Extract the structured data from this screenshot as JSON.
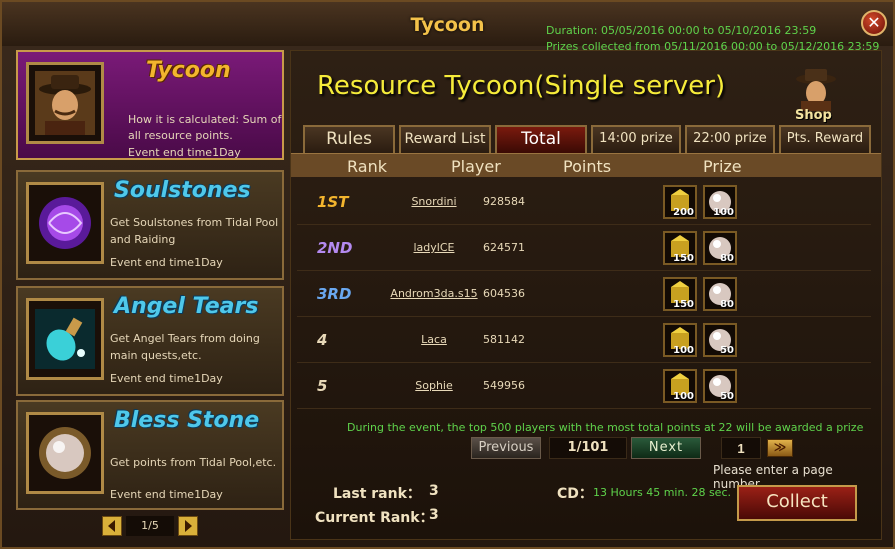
{
  "window": {
    "title": "Tycoon",
    "close": "✕"
  },
  "duration": {
    "line1": "Duration: 05/05/2016 00:00 to 05/10/2016 23:59",
    "line2": "Prizes collected from 05/11/2016 00:00 to 05/12/2016 23:59"
  },
  "sidebar": {
    "cards": [
      {
        "title": "Tycoon",
        "desc": "How it is calculated: Sum of all resource points.",
        "end": "Event end time1Day",
        "active": true
      },
      {
        "title": "Soulstones",
        "desc": "Get Soulstones from Tidal Pool and Raiding",
        "end": "Event end time1Day"
      },
      {
        "title": "Angel Tears",
        "desc": "Get Angel Tears from doing main quests,etc.",
        "end": "Event end time1Day"
      },
      {
        "title": "Bless Stone",
        "desc": "Get points from Tidal Pool,etc.",
        "end": "Event end time1Day"
      }
    ],
    "pager": "1/5"
  },
  "main": {
    "title": "Resource Tycoon(Single server)",
    "shop_label": "Shop",
    "tabs": [
      "Rules",
      "Reward List",
      "Total",
      "14:00 prize",
      "22:00 prize",
      "Pts. Reward"
    ],
    "active_tab": "Total",
    "headers": {
      "rank": "Rank",
      "player": "Player",
      "points": "Points",
      "prize": "Prize"
    }
  },
  "leaderboard": [
    {
      "rank": "1ST",
      "player": "Snordini",
      "points": "928584",
      "prize1": "200",
      "prize2": "100"
    },
    {
      "rank": "2ND",
      "player": "ladylCE",
      "points": "624571",
      "prize1": "150",
      "prize2": "80"
    },
    {
      "rank": "3RD",
      "player": "Androm3da.s15",
      "points": "604536",
      "prize1": "150",
      "prize2": "80"
    },
    {
      "rank": "4",
      "player": "Laca",
      "points": "581142",
      "prize1": "100",
      "prize2": "50"
    },
    {
      "rank": "5",
      "player": "Sophie",
      "points": "549956",
      "prize1": "100",
      "prize2": "50"
    }
  ],
  "note": "During the event, the top 500 players with the most total points at 22 will be awarded a prize",
  "pagination": {
    "previous": "Previous",
    "page_info": "1/101",
    "next": "Next",
    "input_value": "1",
    "go": "≫",
    "hint": "Please enter a page number."
  },
  "footer": {
    "last_rank_label": "Last rank：",
    "last_rank_value": "3",
    "current_rank_label": "Current Rank：",
    "current_rank_value": "3",
    "cd_label": "CD：",
    "cd_value": "13 Hours 45 min. 28 sec.",
    "collect": "Collect"
  },
  "colors": {
    "rank1": "#f3b52e",
    "rank2": "#b48af0",
    "rank3": "#6aa8f0",
    "rankN": "#e8d9b8",
    "green_text": "#5fd34b"
  }
}
